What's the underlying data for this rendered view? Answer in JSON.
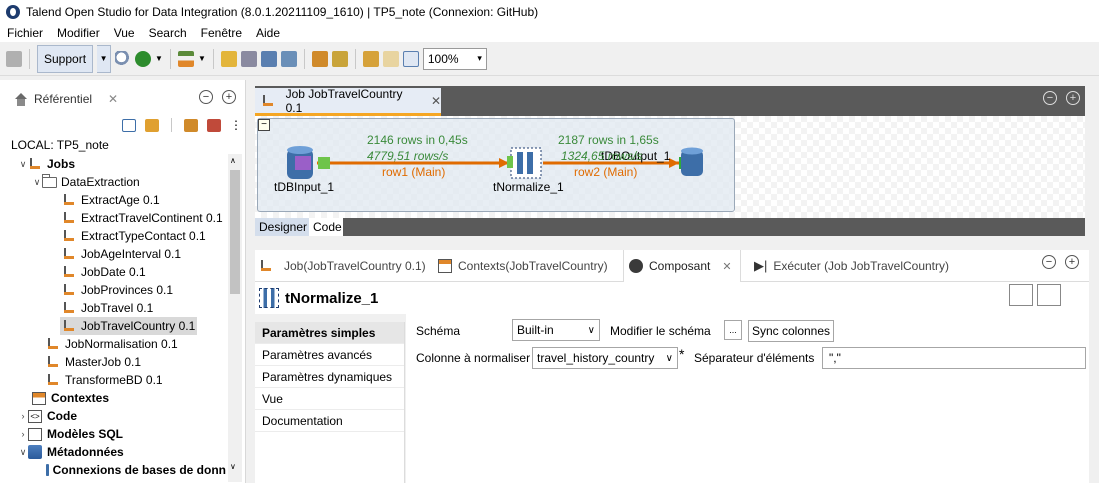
{
  "window": {
    "title": "Talend Open Studio for Data Integration (8.0.1.20211109_1610) | TP5_note (Connexion: GitHub)"
  },
  "menu": [
    "Fichier",
    "Modifier",
    "Vue",
    "Search",
    "Fenêtre",
    "Aide"
  ],
  "toolbar": {
    "support_label": "Support",
    "zoom": "100%"
  },
  "repository": {
    "tab_label": "Référentiel",
    "local_label": "LOCAL: TP5_note",
    "tree": [
      {
        "label": "Jobs",
        "bold": true
      },
      {
        "label": "DataExtraction",
        "bold": false
      },
      {
        "label": "ExtractAge 0.1"
      },
      {
        "label": "ExtractTravelContinent 0.1"
      },
      {
        "label": "ExtractTypeContact 0.1"
      },
      {
        "label": "JobAgeInterval 0.1"
      },
      {
        "label": "JobDate 0.1"
      },
      {
        "label": "JobProvinces 0.1"
      },
      {
        "label": "JobTravel 0.1"
      },
      {
        "label": "JobTravelCountry 0.1"
      },
      {
        "label": "JobNormalisation 0.1"
      },
      {
        "label": "MasterJob 0.1"
      },
      {
        "label": "TransformeBD 0.1"
      },
      {
        "label": "Contextes",
        "bold": true
      },
      {
        "label": "Code",
        "bold": true
      },
      {
        "label": "Modèles SQL",
        "bold": true
      },
      {
        "label": "Métadonnées",
        "bold": true
      },
      {
        "label": "Connexions de bases de donn",
        "bold": true
      }
    ]
  },
  "job_editor": {
    "tab_label": "Job JobTravelCountry 0.1",
    "components": {
      "input": "tDBInput_1",
      "normalize": "tNormalize_1",
      "output": "tDBOutput_1"
    },
    "row1": {
      "rows": "2146 rows in 0,45s",
      "rate": "4779,51 rows/s",
      "label": "row1 (Main)"
    },
    "row2": {
      "rows": "2187 rows in 1,65s",
      "rate": "1324,65 rows/s",
      "label": "row2 (Main)"
    },
    "tabs": [
      "Designer",
      "Code"
    ]
  },
  "bottom_tabs": [
    {
      "label": "Job(JobTravelCountry 0.1)"
    },
    {
      "label": "Contexts(JobTravelCountry)"
    },
    {
      "label": "Composant"
    },
    {
      "label": "Exécuter (Job JobTravelCountry)"
    }
  ],
  "component_panel": {
    "title": "tNormalize_1",
    "nav": [
      "Paramètres simples",
      "Paramètres avancés",
      "Paramètres dynamiques",
      "Vue",
      "Documentation"
    ],
    "schema_label": "Schéma",
    "schema_value": "Built-in",
    "edit_schema_label": "Modifier le schéma",
    "ellipsis": "...",
    "sync_label": "Sync colonnes",
    "column_label": "Colonne à normaliser",
    "column_value": "travel_history_country",
    "required_mark": "*",
    "separator_label": "Séparateur d'éléments",
    "separator_value": "\",\""
  },
  "colors": {
    "accent_tab": "#f5a623",
    "flow": "#e06b00",
    "stats": "#3a8a3a",
    "dark_bar": "#5a5a5a"
  }
}
